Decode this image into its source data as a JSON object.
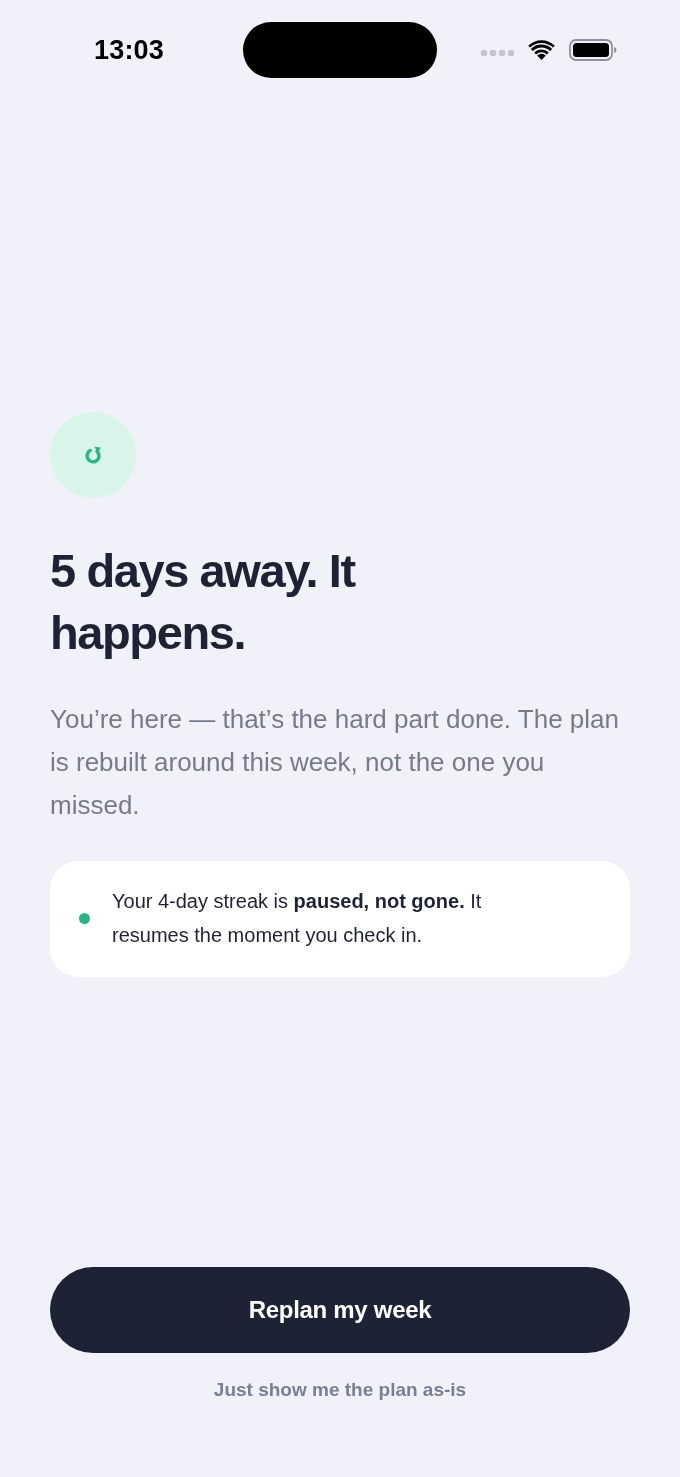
{
  "status_bar": {
    "time": "13:03"
  },
  "headline": "5 days away. It happens.",
  "body": "You’re here — that’s the hard part done. The plan is rebuilt around this week, not the one you missed.",
  "streak_note": {
    "text": "Your 4-day streak is **paused, not gone.** It resumes the moment you check in."
  },
  "actions": {
    "primary": "Replan my week",
    "secondary": "Just show me the plan as-is"
  }
}
